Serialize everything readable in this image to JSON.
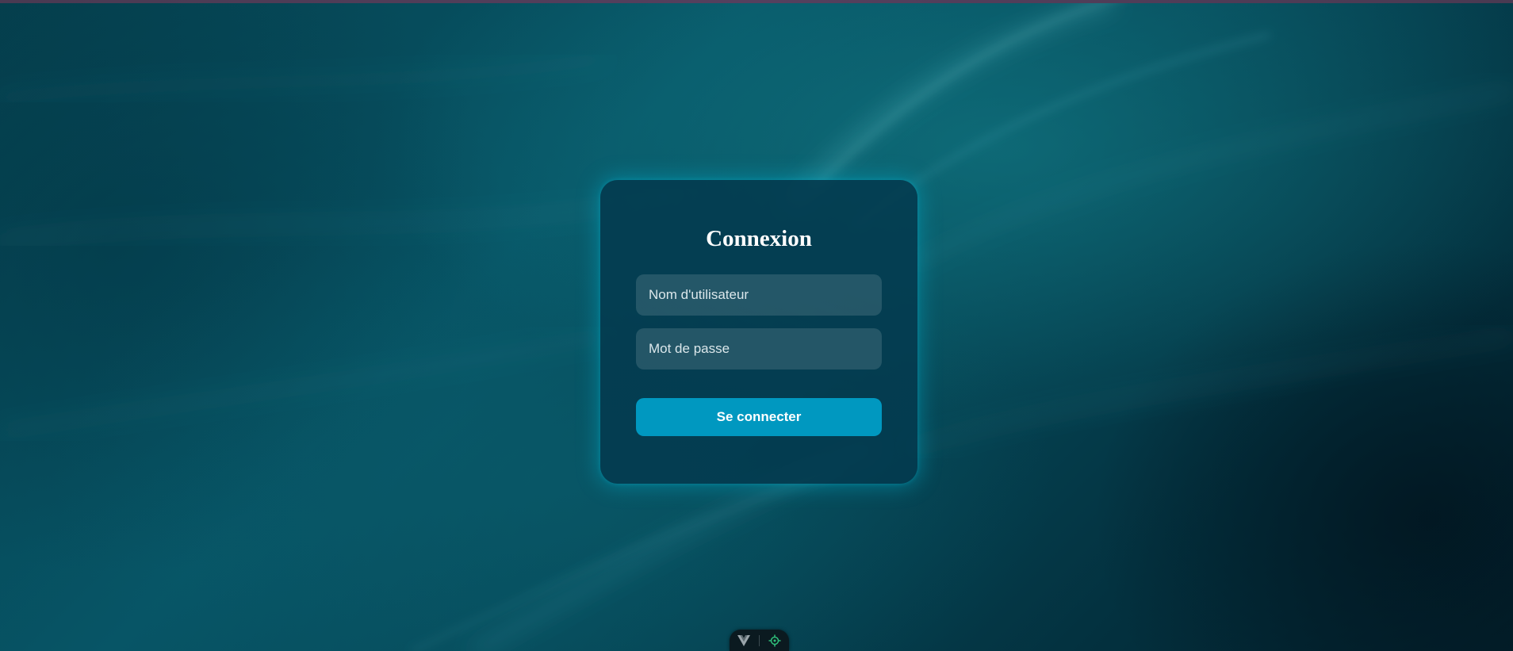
{
  "login": {
    "title": "Connexion",
    "username_placeholder": "Nom d'utilisateur",
    "username_value": "",
    "password_placeholder": "Mot de passe",
    "password_value": "",
    "submit_label": "Se connecter"
  },
  "dev_toolbar": {
    "left_icon": "vue-logo-icon",
    "right_icon": "inspect-target-icon"
  },
  "colors": {
    "accent": "#0098c0",
    "card_background": "#033a4e",
    "page_background": "#02232f",
    "glow": "#00aac8",
    "toolbar_target": "#2fbf7a"
  }
}
